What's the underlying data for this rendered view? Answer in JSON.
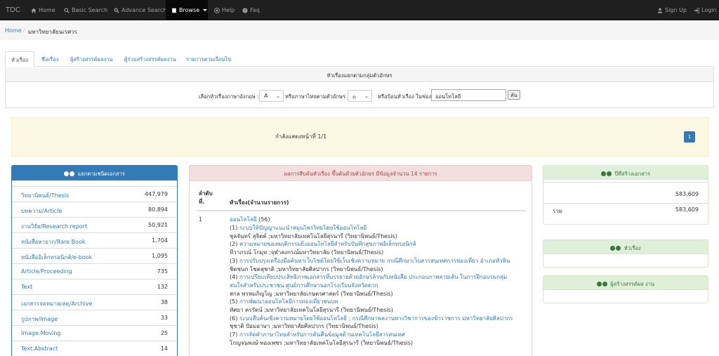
{
  "navbar": {
    "brand": "TDC",
    "items": [
      {
        "label": "Home",
        "icon": "home-icon"
      },
      {
        "label": "Basic Search",
        "icon": "search-icon"
      },
      {
        "label": "Advance Search",
        "icon": "zoom-in-icon"
      },
      {
        "label": "Browse",
        "icon": "book-icon"
      },
      {
        "label": "Help",
        "icon": "help-icon"
      },
      {
        "label": "Faq",
        "icon": "question-icon"
      }
    ],
    "right": [
      {
        "label": "Sign Up",
        "icon": "user-icon"
      },
      {
        "label": "Login",
        "icon": "login-icon"
      }
    ]
  },
  "breadcrumb": {
    "home": "Home",
    "separator": "/",
    "current": "มหาวิทยาลัยนเรศวร"
  },
  "tabs": [
    {
      "label": "หัวเรื่อง",
      "active": true
    },
    {
      "label": "ชื่อเรื่อง",
      "active": false
    },
    {
      "label": "ผู้สร้างสรรค์ผลงาน",
      "active": false
    },
    {
      "label": "ผู้ร่วมสร้างสรรค์ผลงาน",
      "active": false
    },
    {
      "label": "รายการตามเงื่อนไข",
      "active": false
    }
  ],
  "search": {
    "heading": "หัวเรื่องแยกตามกลุ่มตัวอักษร",
    "english_label": "เลือกหัวเรื่องภาษาอังกฤษ :",
    "english_value": "A",
    "thai_label": "หรือภาษาไทยตามตัวอักษร :",
    "thai_value": "ก",
    "keyword_label": "หรือป้อนหัวเรื่อง ในช่อง",
    "keyword_value": "ออนโทโลยี",
    "button": "ค้น"
  },
  "pager": {
    "text": "กำลังแสดงหน้าที่ 1/1",
    "page": "1"
  },
  "doc_types": {
    "heading": "แยกตามชนิดเอกสาร",
    "items": [
      {
        "label": "วิทยานิพนธ์/Thesis",
        "count": "447,979"
      },
      {
        "label": "บทความ/Article",
        "count": "80,894"
      },
      {
        "label": "งานวิจัย/Research report",
        "count": "50,921"
      },
      {
        "label": "หนังสือหายาก/Rare Book",
        "count": "1,704"
      },
      {
        "label": "หนังสืออิเล็กทรอนิกส์/e-book",
        "count": "1,095"
      },
      {
        "label": "Article/Proceeding",
        "count": "735"
      },
      {
        "label": "Text",
        "count": "132"
      },
      {
        "label": "เอกสารจดหมายเหตุ/Archive",
        "count": "38"
      },
      {
        "label": "รูปภาพ/Image",
        "count": "33"
      },
      {
        "label": "Image.Moving",
        "count": "25"
      },
      {
        "label": "Text.Abstract",
        "count": "14"
      }
    ]
  },
  "results": {
    "heading": "ผลการสืบค้นหัวเรื่อง ขึ้นต้นด้วยตัวอักษร มีข้อมูลจำนวน 14 รายการ",
    "col_no_1": "ลำดับ",
    "col_no_2": "ที่.",
    "col_title": "หัวเรื่อง(จำนวนรายการ)",
    "row_number": "1",
    "subject": "ออนโทโลยี",
    "subject_count": "(56)",
    "lines": [
      {
        "prefix": "(1) ",
        "link": "ระบบให้ปัญญาแนะนำสมุนไพรไทยโดยใช้ออนโทโลยี",
        "text": ""
      },
      {
        "prefix": "",
        "link": "",
        "text": "ชุลจันทร์ สุจิตต์ ;มหาวิทยาลัยเทคโนโลยีสุรนารี (วิทยานิพนธ์/Thesis)"
      },
      {
        "prefix": "(2) ",
        "link": "ความหมายของพฤติกรรมยิ่งออนโทโลยีสำหรับบันทึกสุขภาพอิเล็กทรอนิกส์",
        "text": ""
      },
      {
        "prefix": "",
        "link": "",
        "text": "ทีวาภรณ์ โกมุท ;จุฬาลงกรณ์มหาวิทยาลัย (วิทยานิพนธ์/Thesis)"
      },
      {
        "prefix": "(3) ",
        "link": "การปรับปรุงเครื่องมือค้นหาเว็บไซต์โดยใช้เว็บเชิงความหมาย กรณีศึกษาเว็บสารสนเทศการท่องเที่ยว อำเภอหัวหิน",
        "text": ""
      },
      {
        "prefix": "",
        "link": "",
        "text": "ชิดชนก โชคสุชาติ ;มหาวิทยาลัยศิลปากร (วิทยานิพนธ์/Thesis)"
      },
      {
        "prefix": "(4) ",
        "link": "การเปรียบเทียบประสิทธิภาพเอกสารที่บรรยายด้วยอักษรล้วนกับหนังสือ ประกอบภาพลายเส้น ในการฝึกอบรมกลุ่ม",
        "text": ""
      },
      {
        "prefix": "",
        "link": "สนใจสำหรับประชาชน ศูนย์การศึกษานอกโรงเรียนจังหวัดตาก",
        "text": ""
      },
      {
        "prefix": "",
        "link": "",
        "text": "สกล พรหมภิญโญ ;มหาวิทยาลัยเกษตรศาสตร์ (วิทยานิพนธ์/Thesis)"
      },
      {
        "prefix": "(5) ",
        "link": "การพัฒนาออนโทโลยีการท่องเที่ยวชนบท",
        "text": ""
      },
      {
        "prefix": "",
        "link": "",
        "text": "ทัศยา ครรัตน์ ;มหาวิทยาลัยเทคโนโลยีสุรนารี (วิทยานิพนธ์/Thesis)"
      },
      {
        "prefix": "(6) ",
        "link": "ระบบสืบค้นเชิงความหมายโดยใช้ออนโทโลยี : กรณีศึกษาพลงานทางวิชาการของข้าราชการ มหาวิทยาลัยศิลปากร",
        "text": ""
      },
      {
        "prefix": "",
        "link": "",
        "text": "ชุชาติ ปัอมอาษา ;มหาวิทยาลัยศิลปากร (วิทยานิพนธ์/Thesis)"
      },
      {
        "prefix": "(7) ",
        "link": "การจัดคำภาษาไทยสำหรับการค้นคืนข้อมูลด้านเทคโนโลยีสารสนเทศ",
        "text": ""
      },
      {
        "prefix": "",
        "link": "",
        "text": "โกญจนพงษ์ ทองเพชร ;มหาวิทยาลัยเทคโนโลยีสุรนารี (วิทยานิพนธ์/Thesis)"
      }
    ]
  },
  "year_panel": {
    "heading": "ปีที่สร้างเอกสาร",
    "value": "583,609",
    "total_label": "รวม",
    "total_value": "583,609"
  },
  "subject_panel": {
    "heading": "หัวเรื่อง"
  },
  "creator_panel": {
    "heading": "ผู้สร้างสรรค์ผล งาน"
  },
  "colors": {
    "navbar": "#1f1f1f",
    "primary": "#337ab7",
    "danger_bg": "#f2dede",
    "success_bg": "#dff0d8",
    "warning_bg": "#fcf8e3"
  }
}
